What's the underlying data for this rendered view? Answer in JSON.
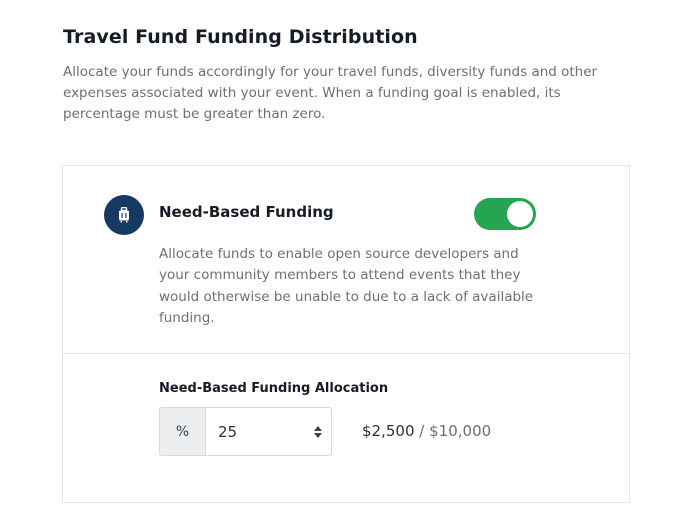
{
  "heading": {
    "title": "Travel Fund Funding Distribution",
    "description": "Allocate your funds accordingly for your travel funds, diversity funds and other expenses associated with your event. When a funding goal is enabled, its percentage must be greater than zero."
  },
  "need_based": {
    "icon": "suitcase-icon",
    "title": "Need-Based Funding",
    "toggle_enabled": true,
    "description": "Allocate funds to enable open source developers and your community members to attend events that they would otherwise be unable to due to a lack of available funding.",
    "allocation_label": "Need-Based Funding Allocation",
    "prefix": "%",
    "percent_value": "25",
    "allocated_amount": "$2,500",
    "separator": "/",
    "total_amount": "$10,000"
  },
  "colors": {
    "icon_bg": "#163a63",
    "toggle_on": "#25a552"
  }
}
